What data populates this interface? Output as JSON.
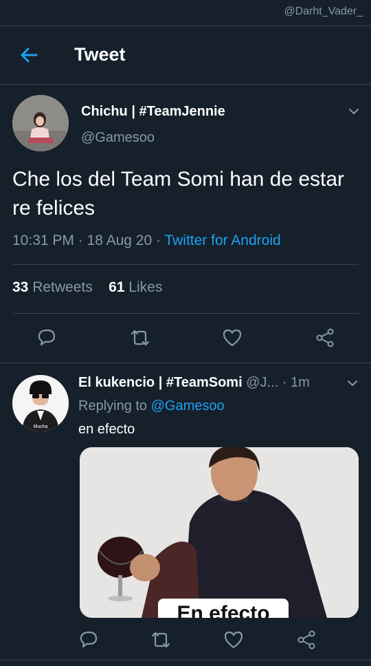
{
  "watermark": "@Darht_Vader_",
  "header": {
    "title": "Tweet"
  },
  "tweet": {
    "author_name": "Chichu | #TeamJennie",
    "author_handle": "@Gamesoo",
    "text": "Che los del Team Somi han de estar re felices",
    "time": "10:31 PM · 18 Aug 20 · ",
    "source": "Twitter for Android",
    "retweets_count": "33",
    "retweets_label": "Retweets",
    "likes_count": "61",
    "likes_label": "Likes"
  },
  "reply": {
    "author_name": "El kukencio | #TeamSomi",
    "author_handle": "@J...",
    "age": "· 1m",
    "replying_prefix": "Replying to ",
    "replying_to": "@Gamesoo",
    "text": "en efecto",
    "avatar_caption": "Mucha",
    "media_caption": "En efecto"
  },
  "colors": {
    "background": "#15202b",
    "accent": "#1da1f2",
    "secondary_text": "#8899a6",
    "divider": "#38444d"
  },
  "icons": {
    "back": "arrow-left-icon",
    "menu": "chevron-down-icon",
    "reply": "comment-icon",
    "retweet": "retweet-icon",
    "like": "heart-icon",
    "share": "share-icon"
  }
}
